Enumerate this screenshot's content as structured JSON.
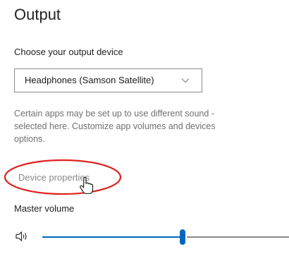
{
  "output": {
    "title": "Output",
    "choose_label": "Choose your output device",
    "device_dropdown": {
      "selected": "Headphones (Samson Satellite)",
      "icon": "chevron-down-icon"
    },
    "description_lines": [
      "Certain apps may be set up to use different sound -",
      "selected here. Customize app volumes and devices",
      "options."
    ],
    "device_properties_link": "Device properties",
    "master_volume": {
      "label": "Master volume",
      "icon": "speaker-icon",
      "level_percent": 57
    }
  },
  "colors": {
    "accent": "#0067c0",
    "annotation": "#e02020",
    "muted_text": "#707070"
  }
}
